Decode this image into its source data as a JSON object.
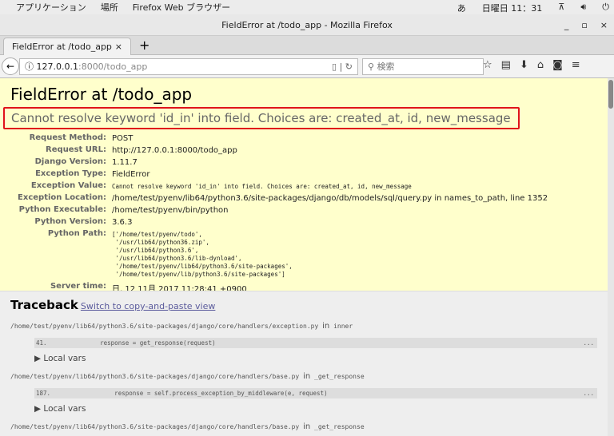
{
  "topbar": {
    "apps": "アプリケーション",
    "places": "場所",
    "app": "Firefox Web ブラウザー",
    "ime": "あ",
    "clock": "日曜日 11：31"
  },
  "window": {
    "title": "FieldError at /todo_app - Mozilla Firefox"
  },
  "tab": {
    "label": "FieldError at /todo_app",
    "close": "×",
    "new": "+"
  },
  "nav": {
    "url_host": "127.0.0.1",
    "url_rest": ":8000/todo_app",
    "search_placeholder": "検索"
  },
  "error": {
    "title": "FieldError at /todo_app",
    "message": "Cannot resolve keyword 'id_in' into field. Choices are: created_at, id, new_message"
  },
  "meta": [
    {
      "label": "Request Method:",
      "value": "POST"
    },
    {
      "label": "Request URL:",
      "value": "http://127.0.0.1:8000/todo_app"
    },
    {
      "label": "Django Version:",
      "value": "1.11.7"
    },
    {
      "label": "Exception Type:",
      "value": "FieldError"
    },
    {
      "label": "Exception Value:",
      "value": "Cannot resolve keyword 'id_in' into field. Choices are: created_at, id, new_message"
    },
    {
      "label": "Exception Location:",
      "value": "/home/test/pyenv/lib64/python3.6/site-packages/django/db/models/sql/query.py in names_to_path, line 1352"
    },
    {
      "label": "Python Executable:",
      "value": "/home/test/pyenv/bin/python"
    },
    {
      "label": "Python Version:",
      "value": "3.6.3"
    },
    {
      "label": "Python Path:",
      "value": "['/home/test/pyenv/todo',\n '/usr/lib64/python36.zip',\n '/usr/lib64/python3.6',\n '/usr/lib64/python3.6/lib-dynload',\n '/home/test/pyenv/lib64/python3.6/site-packages',\n '/home/test/pyenv/lib/python3.6/site-packages']"
    },
    {
      "label": "Server time:",
      "value": "日, 12 11月 2017 11:28:41 +0900"
    }
  ],
  "traceback": {
    "title": "Traceback",
    "switch_link": "Switch to copy-and-paste view",
    "in": "in",
    "local_vars": "Local vars",
    "dots": "...",
    "frames": [
      {
        "path": "/home/test/pyenv/lib64/python3.6/site-packages/django/core/handlers/exception.py",
        "func": "inner",
        "line": "41.",
        "code": "        response = get_response(request)"
      },
      {
        "path": "/home/test/pyenv/lib64/python3.6/site-packages/django/core/handlers/base.py",
        "func": "_get_response",
        "line": "187.",
        "code": "            response = self.process_exception_by_middleware(e, request)"
      },
      {
        "path": "/home/test/pyenv/lib64/python3.6/site-packages/django/core/handlers/base.py",
        "func": "_get_response"
      }
    ]
  }
}
